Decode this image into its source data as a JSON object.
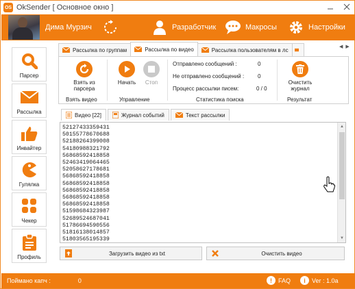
{
  "window": {
    "title": "OkSender [ Основное окно ]",
    "logo_text": "OS"
  },
  "header": {
    "user_name": "Дима Мурзич",
    "developer_label": "Разработчик",
    "macros_label": "Макросы",
    "settings_label": "Настройки"
  },
  "sidebar": {
    "items": [
      {
        "label": "Парсер",
        "icon": "search-icon"
      },
      {
        "label": "Рассылка",
        "icon": "envelope-icon"
      },
      {
        "label": "Инвайтер",
        "icon": "thumbs-up-icon"
      },
      {
        "label": "Гулялка",
        "icon": "pacman-icon"
      },
      {
        "label": "Чекер",
        "icon": "grid-icon"
      },
      {
        "label": "Профиль",
        "icon": "clipboard-icon"
      }
    ]
  },
  "tabs": {
    "top": [
      {
        "label": "Рассылка по группам",
        "active": false
      },
      {
        "label": "Рассылка по видео",
        "active": true
      },
      {
        "label": "Рассылка пользователям в лс",
        "active": false
      }
    ],
    "inner": [
      {
        "label": "Видео [22]",
        "active": true
      },
      {
        "label": "Журнал событий",
        "active": false
      },
      {
        "label": "Текст рассылки",
        "active": false
      }
    ]
  },
  "ribbon": {
    "take_from_parser": "Взять из парсера",
    "start": "Начать",
    "stop": "Стоп",
    "clear_log": "Очистить журнал",
    "groups": {
      "take_video": "Взять видео",
      "control": "Управление",
      "search_stats": "Статистика поиска",
      "result": "Результат"
    },
    "stats": [
      {
        "label": "Отправлено сообщений :",
        "value": "0"
      },
      {
        "label": "Не отправлено сообщений :",
        "value": "0"
      },
      {
        "label": "Процесс рассылки писем:",
        "value": "0 / 0"
      }
    ]
  },
  "video_ids": [
    "52127433359431",
    "50155778670688",
    "52188264399008",
    "54180988321792",
    "56868592418858",
    "52463419064465",
    "52058627178681",
    "56868592418858",
    "56868592418858",
    "56868592418858",
    "56868592418858",
    "56868592418858",
    "51598684323987",
    "52689524687041",
    "51786694590556",
    "51816138014857",
    "51803565195339"
  ],
  "buttons": {
    "load_from_txt": "Загрузить видео из txt",
    "clear_video": "Очистить видео"
  },
  "statusbar": {
    "captcha_label": "Поймано капч :",
    "captcha_count": "0",
    "faq": "FAQ",
    "version": "Ver : 1.0a"
  },
  "colors": {
    "accent": "#f07d10",
    "border": "#cfcfcf"
  }
}
